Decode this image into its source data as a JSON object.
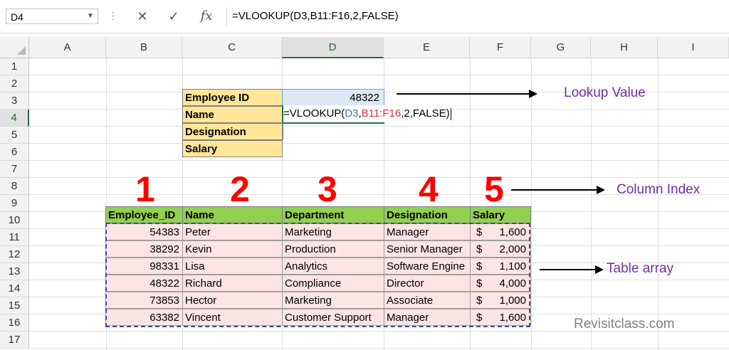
{
  "formula_bar": {
    "name_box": "D4",
    "cancel_icon": "✕",
    "enter_icon": "✓",
    "fx_label": "fx",
    "formula": "=VLOOKUP(D3,B11:F16,2,FALSE)"
  },
  "columns": [
    "A",
    "B",
    "C",
    "D",
    "E",
    "F",
    "G",
    "H",
    "I"
  ],
  "rows": [
    "1",
    "2",
    "3",
    "4",
    "5",
    "6",
    "7",
    "8",
    "9",
    "10",
    "11",
    "12",
    "13",
    "14",
    "15",
    "16",
    "17"
  ],
  "lookup_labels": [
    "Employee ID",
    "Name",
    "Designation",
    "Salary"
  ],
  "lookup_value": "48322",
  "d4_formula": {
    "prefix": "=VLOOKUP(",
    "ref1": "D3",
    "comma1": ",",
    "ref2": "B11:F16",
    "suffix": ",2,FALSE)"
  },
  "column_numbers": [
    "1",
    "2",
    "3",
    "4",
    "5"
  ],
  "table": {
    "headers": [
      "Employee_ID",
      "Name",
      "Department",
      "Designation",
      "Salary"
    ],
    "currency": "$",
    "rows": [
      {
        "id": "54383",
        "name": "Peter",
        "dept": "Marketing",
        "desig": "Manager",
        "salary": "1,600"
      },
      {
        "id": "38292",
        "name": "Kevin",
        "dept": "Production",
        "desig": "Senior Manager",
        "salary": "2,000"
      },
      {
        "id": "98331",
        "name": "Lisa",
        "dept": "Analytics",
        "desig": "Software Engine",
        "salary": "1,100"
      },
      {
        "id": "48322",
        "name": "Richard",
        "dept": "Compliance",
        "desig": "Director",
        "salary": "4,000"
      },
      {
        "id": "73853",
        "name": "Hector",
        "dept": "Marketing",
        "desig": "Associate",
        "salary": "1,000"
      },
      {
        "id": "63382",
        "name": "Vincent",
        "dept": "Customer Support",
        "desig": "Manager",
        "salary": "1,600"
      }
    ]
  },
  "annotations": {
    "lookup_value": "Lookup Value",
    "column_index": "Column Index",
    "table_array": "Table array"
  },
  "watermark": "Revisitclass.com",
  "colors": {
    "label_fill": "#ffe699",
    "header_fill": "#92d050",
    "table_fill": "#fce4e4",
    "annotation": "#7030a0",
    "column_number": "#ff0000",
    "selection": "#217346"
  }
}
